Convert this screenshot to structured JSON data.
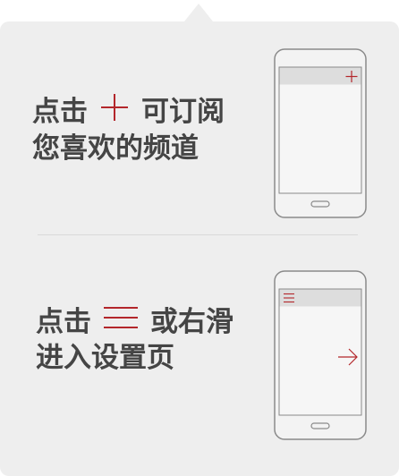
{
  "subscribe_tip": {
    "line1_prefix": "点击",
    "line1_suffix": "可订阅",
    "line2": "您喜欢的频道",
    "plus_icon": "plus-icon"
  },
  "settings_tip": {
    "line1_prefix": "点击",
    "line1_suffix": "或右滑",
    "line2": "进入设置页",
    "menu_icon": "hamburger-menu-icon",
    "arrow_icon": "arrow-right-icon"
  },
  "colors": {
    "panel": "#eeeeee",
    "text": "#454545",
    "accent": "#b3262b",
    "phone_outline": "#8a8a8a",
    "phone_screen": "#f4f4f4",
    "phone_bar": "#dddddd"
  }
}
